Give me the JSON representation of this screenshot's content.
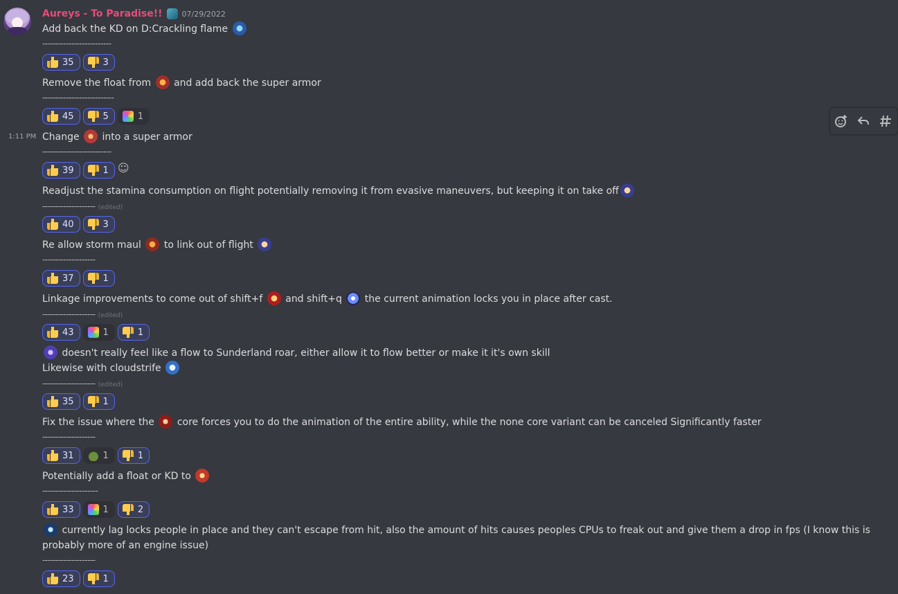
{
  "message": {
    "username": "Aureys - To Paradise!!",
    "date": "07/29/2022",
    "timestamp": "1:11 PM",
    "edited_label": "(edited)"
  },
  "lines": {
    "l1": "Add back the KD on D:Crackling flame",
    "l2a": "Remove the float from",
    "l2b": "and add back the super armor",
    "l3a": "Change",
    "l3b": "into a super armor",
    "l4": "Readjust the stamina consumption on flight  potentially removing it from evasive maneuvers, but keeping it on take off",
    "l5a": "Re allow storm maul",
    "l5b": "to link out of flight",
    "l6a": "Linkage improvements to come out of shift+f",
    "l6b": "and shift+q",
    "l6c": "the current animation locks you in place after cast.",
    "l7a": "doesn't really feel like a flow to Sunderland roar, either allow it to flow better or make it it's own skill",
    "l7b": "Likewise with cloudstrife",
    "l8a": "Fix the issue where the",
    "l8b": "core forces you to do the animation of the entire ability, while the none core variant can be canceled Significantly faster",
    "l9": "Potentially add a float or KD to",
    "l10": "currently lag locks people in place and they can't escape from hit, also the amount of hits causes peoples CPUs to freak out and give them a drop in fps (I know this is probably more of an engine issue)"
  },
  "separators": {
    "s1": "--------------------------",
    "s2": "---------------------------",
    "s3": "--------------------------",
    "s4": "--------------------",
    "s5": "--------------------",
    "s6": "--------------------",
    "s7": "--------------------",
    "s8": "--------------------",
    "s9": "---------------------",
    "s10": "--------------------"
  },
  "reactions": {
    "r1": {
      "up": "35",
      "down": "3"
    },
    "r2": {
      "up": "45",
      "down": "5",
      "rainbow": "1"
    },
    "r3": {
      "up": "39",
      "down": "1"
    },
    "r4": {
      "up": "40",
      "down": "3"
    },
    "r5": {
      "up": "37",
      "down": "1"
    },
    "r6": {
      "up": "43",
      "rainbow": "1",
      "down": "1"
    },
    "r7": {
      "up": "35",
      "down": "1"
    },
    "r8": {
      "up": "31",
      "frog": "1",
      "down": "1"
    },
    "r9": {
      "up": "33",
      "rainbow": "1",
      "down": "2"
    },
    "r10": {
      "up": "23",
      "down": "1"
    }
  },
  "toolbar_icons": [
    "add-reaction-icon",
    "reply-icon",
    "create-thread-icon"
  ],
  "colors": {
    "username": "#e74c7a",
    "background": "#36393f",
    "reaction_accent": "#5865f2"
  }
}
